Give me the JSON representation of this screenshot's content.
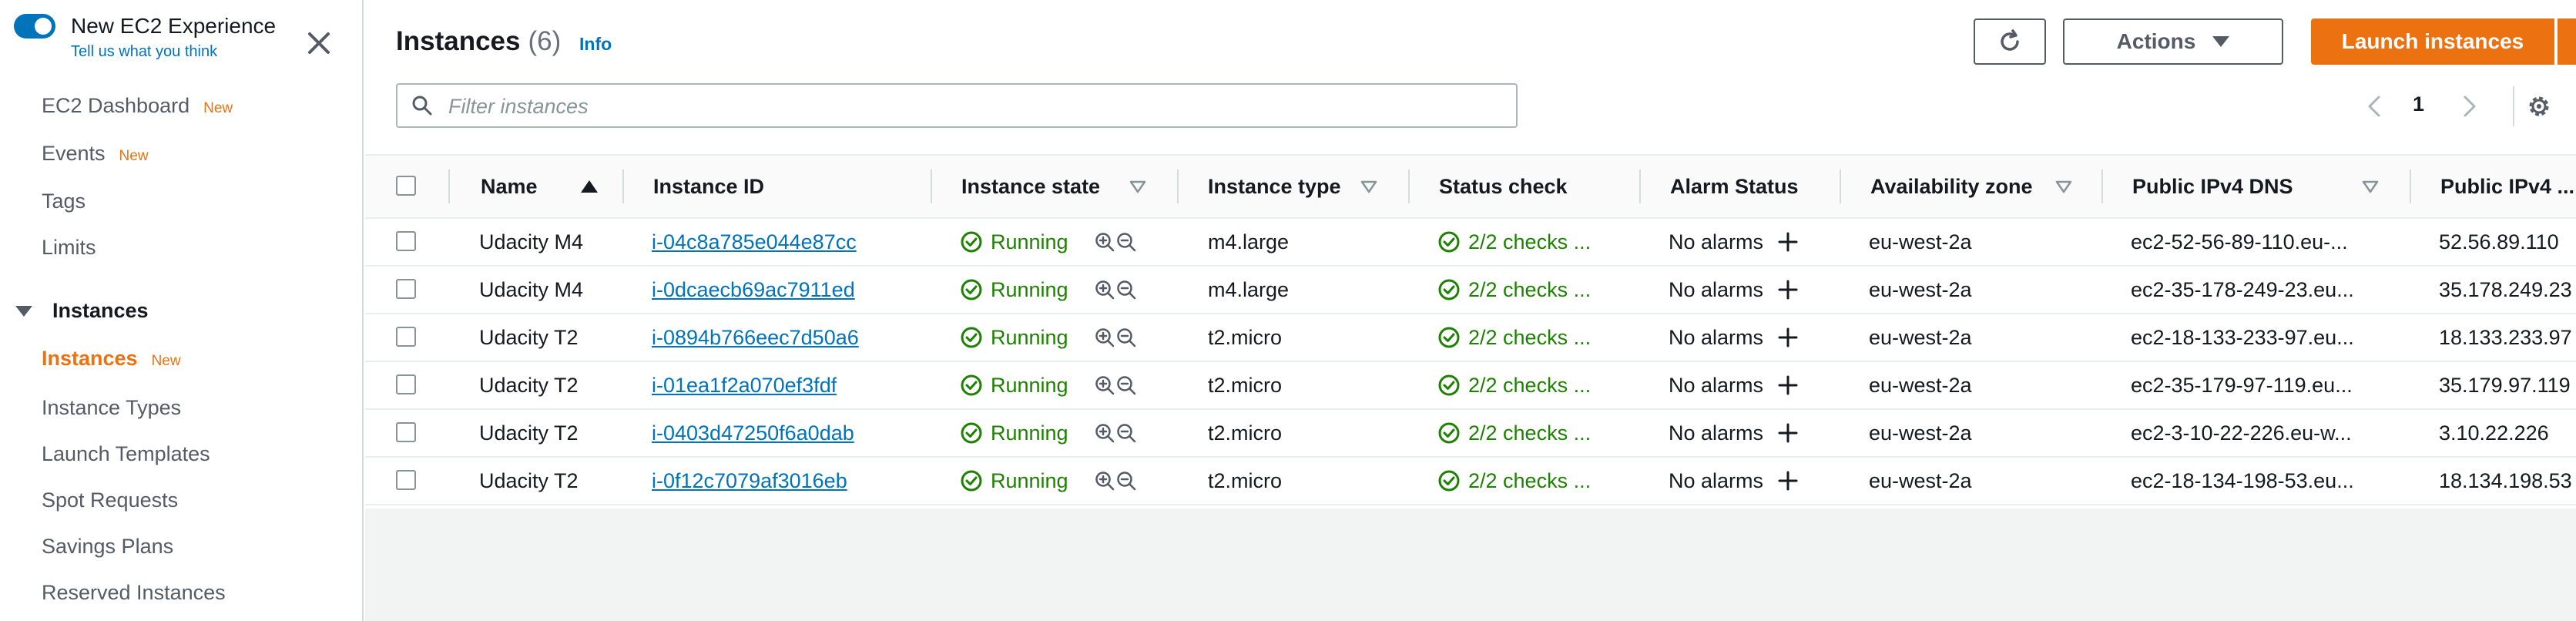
{
  "sidebar": {
    "experience_toggle": {
      "title": "New EC2 Experience",
      "link": "Tell us what you think",
      "on": true
    },
    "nav": [
      {
        "label": "EC2 Dashboard",
        "badge": "New"
      },
      {
        "label": "Events",
        "badge": "New"
      },
      {
        "label": "Tags"
      },
      {
        "label": "Limits"
      }
    ],
    "section": {
      "label": "Instances",
      "expanded": true
    },
    "section_items": [
      {
        "label": "Instances",
        "badge": "New",
        "active": true
      },
      {
        "label": "Instance Types"
      },
      {
        "label": "Launch Templates"
      },
      {
        "label": "Spot Requests"
      },
      {
        "label": "Savings Plans"
      },
      {
        "label": "Reserved Instances"
      }
    ]
  },
  "header": {
    "title": "Instances",
    "count": "(6)",
    "info": "Info",
    "refresh_icon": "refresh-icon",
    "actions_label": "Actions",
    "launch_label": "Launch instances",
    "accent_color": "#ec7211"
  },
  "filter": {
    "placeholder": "Filter instances"
  },
  "pagination": {
    "page": "1"
  },
  "table": {
    "columns": {
      "name": "Name",
      "instance_id": "Instance ID",
      "state": "Instance state",
      "type": "Instance type",
      "status": "Status check",
      "alarm": "Alarm Status",
      "az": "Availability zone",
      "dns": "Public IPv4 DNS",
      "ip": "Public IPv4 ..."
    },
    "rows": [
      {
        "name": "Udacity M4",
        "id": "i-04c8a785e044e87cc",
        "state": "Running",
        "type": "m4.large",
        "status": "2/2 checks ...",
        "alarm": "No alarms",
        "az": "eu-west-2a",
        "dns": "ec2-52-56-89-110.eu-...",
        "ip": "52.56.89.110"
      },
      {
        "name": "Udacity M4",
        "id": "i-0dcaecb69ac7911ed",
        "state": "Running",
        "type": "m4.large",
        "status": "2/2 checks ...",
        "alarm": "No alarms",
        "az": "eu-west-2a",
        "dns": "ec2-35-178-249-23.eu...",
        "ip": "35.178.249.23"
      },
      {
        "name": "Udacity T2",
        "id": "i-0894b766eec7d50a6",
        "state": "Running",
        "type": "t2.micro",
        "status": "2/2 checks ...",
        "alarm": "No alarms",
        "az": "eu-west-2a",
        "dns": "ec2-18-133-233-97.eu...",
        "ip": "18.133.233.97"
      },
      {
        "name": "Udacity T2",
        "id": "i-01ea1f2a070ef3fdf",
        "state": "Running",
        "type": "t2.micro",
        "status": "2/2 checks ...",
        "alarm": "No alarms",
        "az": "eu-west-2a",
        "dns": "ec2-35-179-97-119.eu...",
        "ip": "35.179.97.119"
      },
      {
        "name": "Udacity T2",
        "id": "i-0403d47250f6a0dab",
        "state": "Running",
        "type": "t2.micro",
        "status": "2/2 checks ...",
        "alarm": "No alarms",
        "az": "eu-west-2a",
        "dns": "ec2-3-10-22-226.eu-w...",
        "ip": "3.10.22.226"
      },
      {
        "name": "Udacity T2",
        "id": "i-0f12c7079af3016eb",
        "state": "Running",
        "type": "t2.micro",
        "status": "2/2 checks ...",
        "alarm": "No alarms",
        "az": "eu-west-2a",
        "dns": "ec2-18-134-198-53.eu...",
        "ip": "18.134.198.53"
      }
    ]
  }
}
